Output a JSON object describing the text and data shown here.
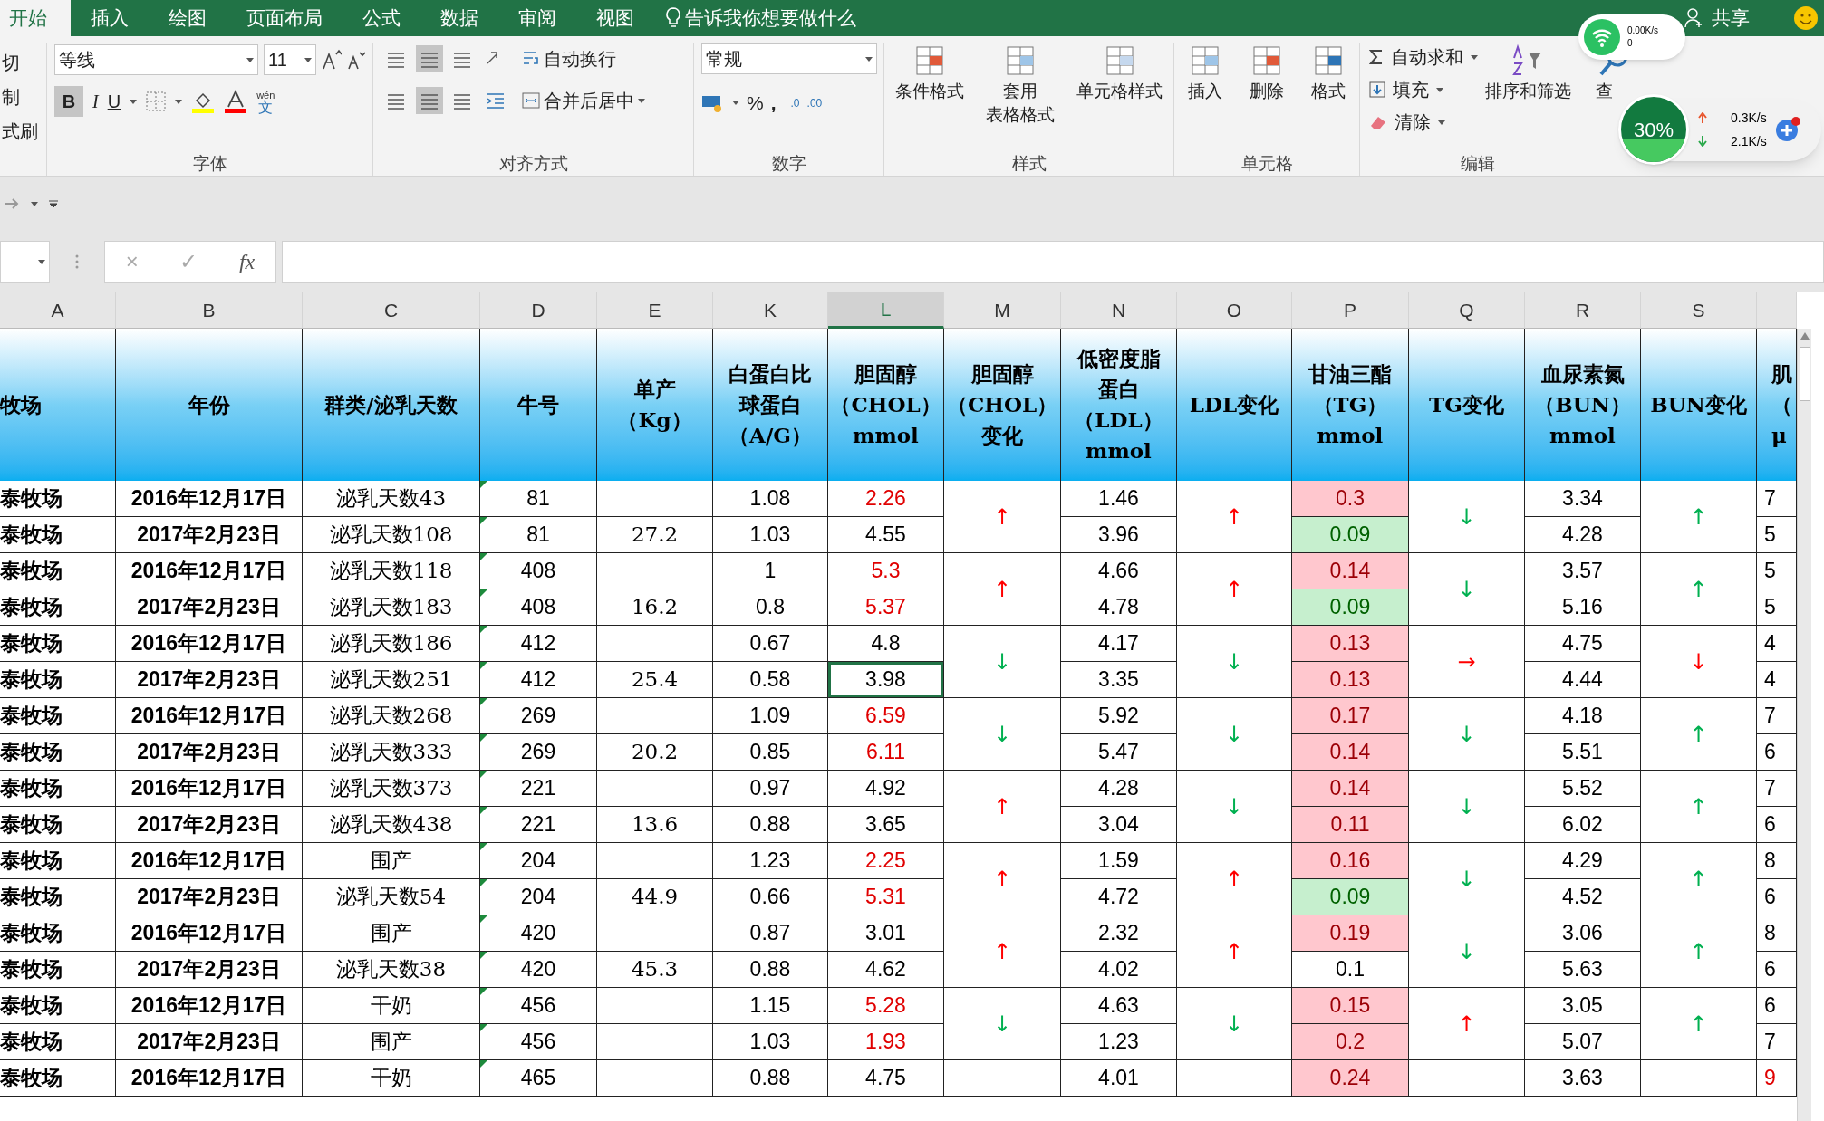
{
  "ribbon_tabs": [
    {
      "label": "开始",
      "selected": true
    },
    {
      "label": "插入",
      "selected": false
    },
    {
      "label": "绘图",
      "selected": false
    },
    {
      "label": "页面布局",
      "selected": false
    },
    {
      "label": "公式",
      "selected": false
    },
    {
      "label": "数据",
      "selected": false
    },
    {
      "label": "审阅",
      "selected": false
    },
    {
      "label": "视图",
      "selected": false
    }
  ],
  "tell_me": "告诉我你想要做什么",
  "share": "共享",
  "clipboard": [
    "切",
    "制",
    "式刷"
  ],
  "font": {
    "name": "等线",
    "size": "11",
    "bold": "B",
    "italic": "I",
    "underline": "U",
    "phonetic_top": "wén",
    "phonetic_bottom": "文",
    "label": "字体"
  },
  "alignment": {
    "wrap": "自动换行",
    "merge": "合并后居中",
    "label": "对齐方式"
  },
  "number": {
    "format": "常规",
    "percent": "%",
    "comma": ",",
    "increase": ".0",
    "decrease": ".00",
    "label": "数字"
  },
  "styles": {
    "buttons": [
      [
        "条件格式"
      ],
      [
        "套用",
        "表格格式"
      ],
      [
        "单元格样式"
      ]
    ],
    "label": "样式"
  },
  "cells": {
    "buttons": [
      "插入",
      "删除",
      "格式"
    ],
    "label": "单元格"
  },
  "editing": {
    "autosum": "自动求和",
    "fill": "填充",
    "clear": "清除",
    "sort": "排序和筛选",
    "find": "查",
    "label": "编辑"
  },
  "net_widget": {
    "wifi_speed": "0.00K/s",
    "wifi_count": "0",
    "percent": "30%",
    "up": "0.3K/s",
    "down": "2.1K/s"
  },
  "formula_bar": {
    "cancel": "×",
    "enter": "✓",
    "fx": "fx"
  },
  "columns": [
    {
      "letter": "A",
      "selected": false,
      "header": [
        "牧场"
      ]
    },
    {
      "letter": "B",
      "selected": false,
      "header": [
        "年份"
      ]
    },
    {
      "letter": "C",
      "selected": false,
      "header": [
        "群类/泌乳天数"
      ]
    },
    {
      "letter": "D",
      "selected": false,
      "header": [
        "牛号"
      ]
    },
    {
      "letter": "E",
      "selected": false,
      "header": [
        "单产",
        "（Kg）"
      ]
    },
    {
      "letter": "K",
      "selected": false,
      "header": [
        "白蛋白比",
        "球蛋白",
        "（A/G）"
      ]
    },
    {
      "letter": "L",
      "selected": true,
      "header": [
        "胆固醇",
        "（CHOL）",
        "mmol"
      ]
    },
    {
      "letter": "M",
      "selected": false,
      "header": [
        "胆固醇",
        "（CHOL）",
        "变化"
      ]
    },
    {
      "letter": "N",
      "selected": false,
      "header": [
        "低密度脂",
        "蛋白",
        "（LDL）",
        "mmol"
      ]
    },
    {
      "letter": "O",
      "selected": false,
      "header": [
        "LDL变化"
      ]
    },
    {
      "letter": "P",
      "selected": false,
      "header": [
        "甘油三酯",
        "（TG）",
        "mmol"
      ]
    },
    {
      "letter": "Q",
      "selected": false,
      "header": [
        "TG变化"
      ]
    },
    {
      "letter": "R",
      "selected": false,
      "header": [
        "血尿素氮",
        "（BUN）",
        "mmol"
      ]
    },
    {
      "letter": "S",
      "selected": false,
      "header": [
        "BUN变化"
      ]
    },
    {
      "selected": false,
      "header": [
        "肌",
        "（",
        "μ"
      ]
    }
  ],
  "rows": [
    {
      "farm": "泰牧场",
      "date": "2016年12月17日",
      "group": "泌乳天数43",
      "cow": "81",
      "yield": "",
      "ag": "1.08",
      "chol": "2.26",
      "chol_high": true,
      "ldl": "1.46",
      "tg": "0.3",
      "tg_high": true,
      "tg_low": false,
      "bun": "3.34",
      "col_t": "7",
      "col_t_high": false,
      "selected": false
    },
    {
      "farm": "泰牧场",
      "date": "2017年2月23日",
      "group": "泌乳天数108",
      "cow": "81",
      "yield": "27.2",
      "ag": "1.03",
      "chol": "4.55",
      "chol_high": false,
      "ldl": "3.96",
      "tg": "0.09",
      "tg_high": false,
      "tg_low": true,
      "bun": "4.28",
      "col_t": "5",
      "col_t_high": false,
      "selected": false
    },
    {
      "farm": "泰牧场",
      "date": "2016年12月17日",
      "group": "泌乳天数118",
      "cow": "408",
      "yield": "",
      "ag": "1",
      "chol": "5.3",
      "chol_high": true,
      "ldl": "4.66",
      "tg": "0.14",
      "tg_high": true,
      "tg_low": false,
      "bun": "3.57",
      "col_t": "5",
      "col_t_high": false,
      "selected": false
    },
    {
      "farm": "泰牧场",
      "date": "2017年2月23日",
      "group": "泌乳天数183",
      "cow": "408",
      "yield": "16.2",
      "ag": "0.8",
      "chol": "5.37",
      "chol_high": true,
      "ldl": "4.78",
      "tg": "0.09",
      "tg_high": false,
      "tg_low": true,
      "bun": "5.16",
      "col_t": "5",
      "col_t_high": false,
      "selected": false
    },
    {
      "farm": "泰牧场",
      "date": "2016年12月17日",
      "group": "泌乳天数186",
      "cow": "412",
      "yield": "",
      "ag": "0.67",
      "chol": "4.8",
      "chol_high": false,
      "ldl": "4.17",
      "tg": "0.13",
      "tg_high": true,
      "tg_low": false,
      "bun": "4.75",
      "col_t": "4",
      "col_t_high": false,
      "selected": false
    },
    {
      "farm": "泰牧场",
      "date": "2017年2月23日",
      "group": "泌乳天数251",
      "cow": "412",
      "yield": "25.4",
      "ag": "0.58",
      "chol": "3.98",
      "chol_high": false,
      "ldl": "3.35",
      "tg": "0.13",
      "tg_high": true,
      "tg_low": false,
      "bun": "4.44",
      "col_t": "4",
      "col_t_high": false,
      "selected": true
    },
    {
      "farm": "泰牧场",
      "date": "2016年12月17日",
      "group": "泌乳天数268",
      "cow": "269",
      "yield": "",
      "ag": "1.09",
      "chol": "6.59",
      "chol_high": true,
      "ldl": "5.92",
      "tg": "0.17",
      "tg_high": true,
      "tg_low": false,
      "bun": "4.18",
      "col_t": "7",
      "col_t_high": false,
      "selected": false
    },
    {
      "farm": "泰牧场",
      "date": "2017年2月23日",
      "group": "泌乳天数333",
      "cow": "269",
      "yield": "20.2",
      "ag": "0.85",
      "chol": "6.11",
      "chol_high": true,
      "ldl": "5.47",
      "tg": "0.14",
      "tg_high": true,
      "tg_low": false,
      "bun": "5.51",
      "col_t": "6",
      "col_t_high": false,
      "selected": false
    },
    {
      "farm": "泰牧场",
      "date": "2016年12月17日",
      "group": "泌乳天数373",
      "cow": "221",
      "yield": "",
      "ag": "0.97",
      "chol": "4.92",
      "chol_high": false,
      "ldl": "4.28",
      "tg": "0.14",
      "tg_high": true,
      "tg_low": false,
      "bun": "5.52",
      "col_t": "7",
      "col_t_high": false,
      "selected": false
    },
    {
      "farm": "泰牧场",
      "date": "2017年2月23日",
      "group": "泌乳天数438",
      "cow": "221",
      "yield": "13.6",
      "ag": "0.88",
      "chol": "3.65",
      "chol_high": false,
      "ldl": "3.04",
      "tg": "0.11",
      "tg_high": true,
      "tg_low": false,
      "bun": "6.02",
      "col_t": "6",
      "col_t_high": false,
      "selected": false
    },
    {
      "farm": "泰牧场",
      "date": "2016年12月17日",
      "group": "围产",
      "cow": "204",
      "yield": "",
      "ag": "1.23",
      "chol": "2.25",
      "chol_high": true,
      "ldl": "1.59",
      "tg": "0.16",
      "tg_high": true,
      "tg_low": false,
      "bun": "4.29",
      "col_t": "8",
      "col_t_high": false,
      "selected": false
    },
    {
      "farm": "泰牧场",
      "date": "2017年2月23日",
      "group": "泌乳天数54",
      "cow": "204",
      "yield": "44.9",
      "ag": "0.66",
      "chol": "5.31",
      "chol_high": true,
      "ldl": "4.72",
      "tg": "0.09",
      "tg_high": false,
      "tg_low": true,
      "bun": "4.52",
      "col_t": "6",
      "col_t_high": false,
      "selected": false
    },
    {
      "farm": "泰牧场",
      "date": "2016年12月17日",
      "group": "围产",
      "cow": "420",
      "yield": "",
      "ag": "0.87",
      "chol": "3.01",
      "chol_high": false,
      "ldl": "2.32",
      "tg": "0.19",
      "tg_high": true,
      "tg_low": false,
      "bun": "3.06",
      "col_t": "8",
      "col_t_high": false,
      "selected": false
    },
    {
      "farm": "泰牧场",
      "date": "2017年2月23日",
      "group": "泌乳天数38",
      "cow": "420",
      "yield": "45.3",
      "ag": "0.88",
      "chol": "4.62",
      "chol_high": false,
      "ldl": "4.02",
      "tg": "0.1",
      "tg_high": false,
      "tg_low": false,
      "bun": "5.63",
      "col_t": "6",
      "col_t_high": false,
      "selected": false
    },
    {
      "farm": "泰牧场",
      "date": "2016年12月17日",
      "group": "干奶",
      "cow": "456",
      "yield": "",
      "ag": "1.15",
      "chol": "5.28",
      "chol_high": true,
      "ldl": "4.63",
      "tg": "0.15",
      "tg_high": true,
      "tg_low": false,
      "bun": "3.05",
      "col_t": "6",
      "col_t_high": false,
      "selected": false
    },
    {
      "farm": "泰牧场",
      "date": "2017年2月23日",
      "group": "围产",
      "cow": "456",
      "yield": "",
      "ag": "1.03",
      "chol": "1.93",
      "chol_high": true,
      "ldl": "1.23",
      "tg": "0.2",
      "tg_high": true,
      "tg_low": false,
      "bun": "5.07",
      "col_t": "7",
      "col_t_high": false,
      "selected": false
    },
    {
      "farm": "泰牧场",
      "date": "2016年12月17日",
      "group": "干奶",
      "cow": "465",
      "yield": "",
      "ag": "0.88",
      "chol": "4.75",
      "chol_high": false,
      "ldl": "4.01",
      "tg": "0.24",
      "tg_high": true,
      "tg_low": false,
      "bun": "3.63",
      "col_t": "9",
      "col_t_high": true,
      "selected": false
    }
  ],
  "changes": [
    {
      "arrows": [
        {
          "text": "↑",
          "color": "#ff0000"
        },
        {
          "text": "↑",
          "color": "#ff0000"
        },
        {
          "text": "↓",
          "color": "#00b050"
        },
        {
          "text": "↑",
          "color": "#00b050"
        }
      ]
    },
    {
      "arrows": [
        {
          "text": "↑",
          "color": "#ff0000"
        },
        {
          "text": "↑",
          "color": "#ff0000"
        },
        {
          "text": "↓",
          "color": "#00b050"
        },
        {
          "text": "↑",
          "color": "#00b050"
        }
      ]
    },
    {
      "arrows": [
        {
          "text": "↓",
          "color": "#00b050"
        },
        {
          "text": "↓",
          "color": "#00b050"
        },
        {
          "text": "→",
          "color": "#ff0000"
        },
        {
          "text": "↓",
          "color": "#ff0000"
        }
      ]
    },
    {
      "arrows": [
        {
          "text": "↓",
          "color": "#00b050"
        },
        {
          "text": "↓",
          "color": "#00b050"
        },
        {
          "text": "↓",
          "color": "#00b050"
        },
        {
          "text": "↑",
          "color": "#00b050"
        }
      ]
    },
    {
      "arrows": [
        {
          "text": "↑",
          "color": "#ff0000"
        },
        {
          "text": "↓",
          "color": "#00b050"
        },
        {
          "text": "↓",
          "color": "#00b050"
        },
        {
          "text": "↑",
          "color": "#00b050"
        }
      ]
    },
    {
      "arrows": [
        {
          "text": "↑",
          "color": "#ff0000"
        },
        {
          "text": "↑",
          "color": "#ff0000"
        },
        {
          "text": "↓",
          "color": "#00b050"
        },
        {
          "text": "↑",
          "color": "#00b050"
        }
      ]
    },
    {
      "arrows": [
        {
          "text": "↑",
          "color": "#ff0000"
        },
        {
          "text": "↑",
          "color": "#ff0000"
        },
        {
          "text": "↓",
          "color": "#00b050"
        },
        {
          "text": "↑",
          "color": "#00b050"
        }
      ]
    },
    {
      "arrows": [
        {
          "text": "↓",
          "color": "#00b050"
        },
        {
          "text": "↓",
          "color": "#00b050"
        },
        {
          "text": "↑",
          "color": "#ff0000"
        },
        {
          "text": "↑",
          "color": "#00b050"
        }
      ]
    }
  ]
}
